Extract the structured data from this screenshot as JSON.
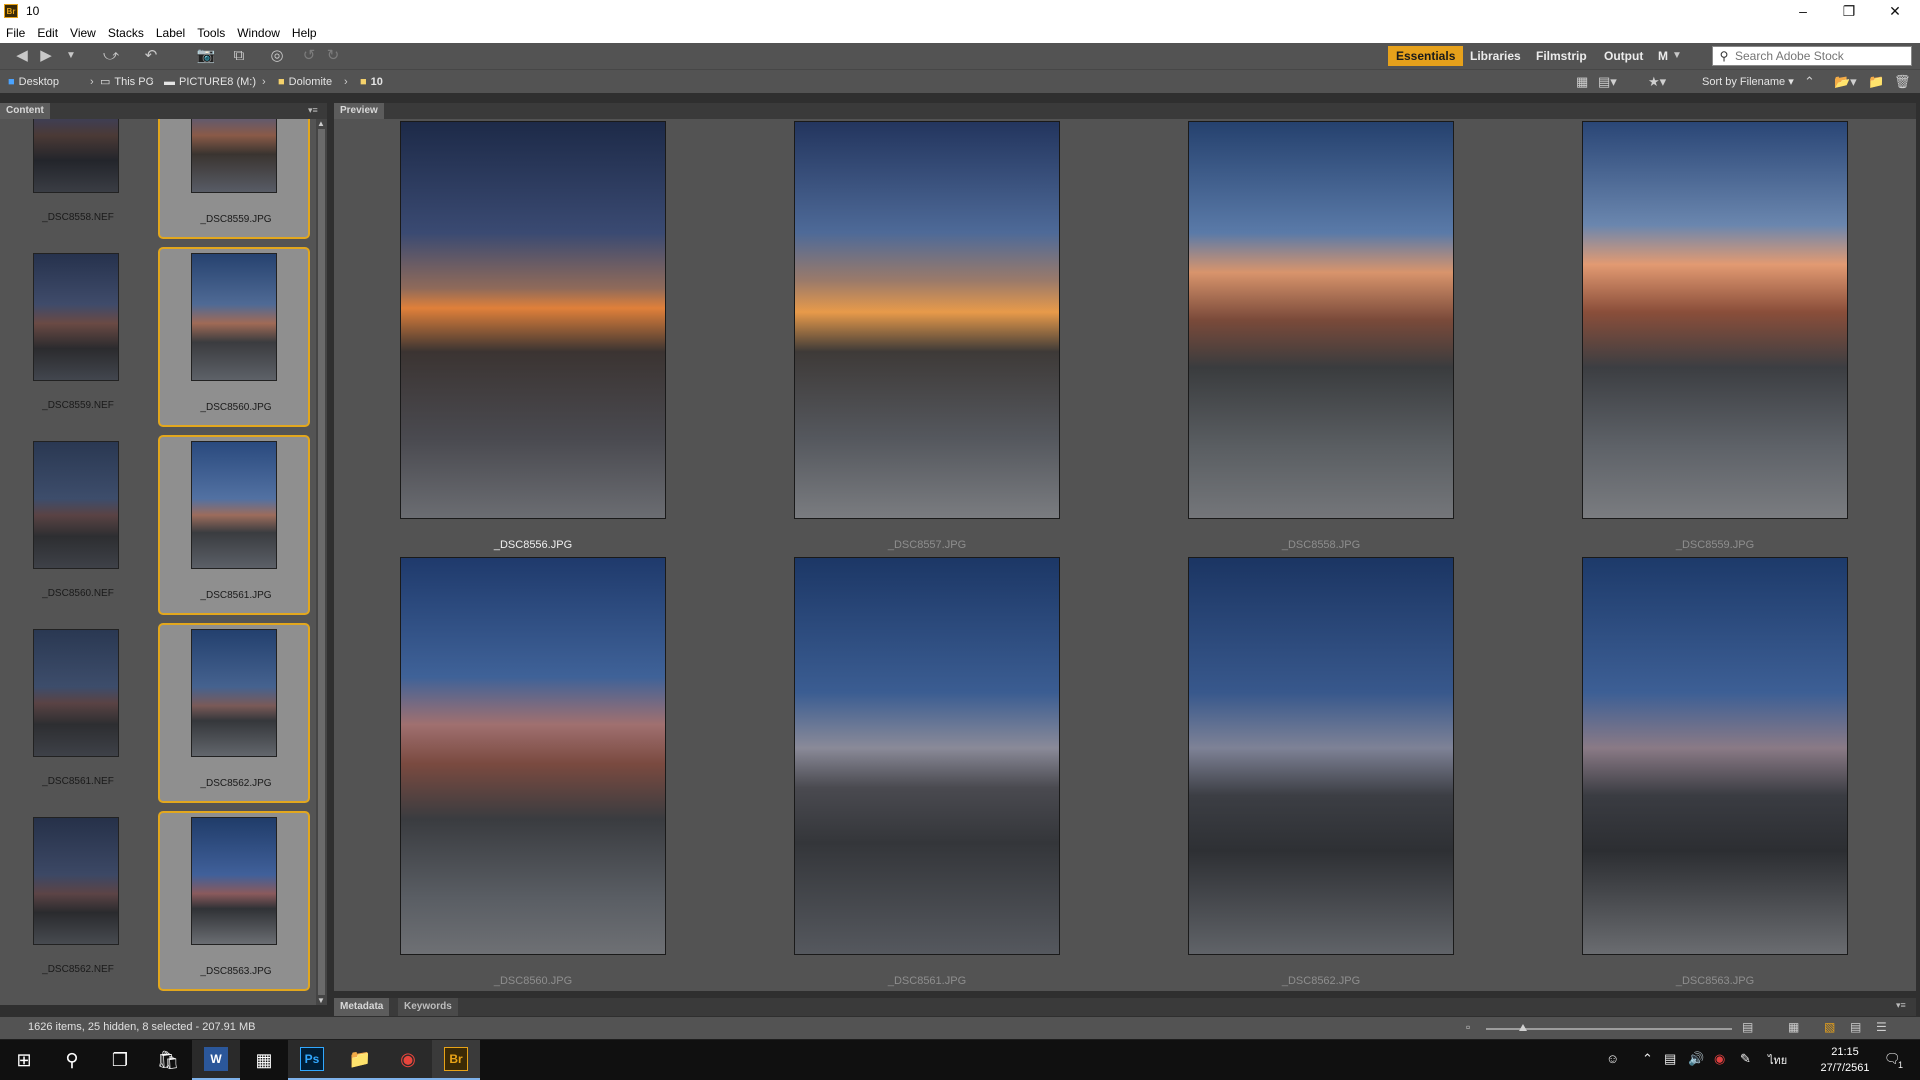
{
  "window": {
    "title": "10"
  },
  "menu": [
    "File",
    "Edit",
    "View",
    "Stacks",
    "Label",
    "Tools",
    "Window",
    "Help"
  ],
  "workspaces": {
    "tabs": [
      "Essentials",
      "Libraries",
      "Filmstrip",
      "Output",
      "M"
    ],
    "active": "Essentials"
  },
  "search": {
    "placeholder": "Search Adobe Stock"
  },
  "path": [
    {
      "label": "Desktop",
      "icon": "desktop-folder-icon"
    },
    {
      "label": "This PC",
      "icon": "computer-icon"
    },
    {
      "label": "PICTURE8 (M:)",
      "icon": "drive-icon"
    },
    {
      "label": "Dolomite",
      "icon": "folder-icon"
    },
    {
      "label": "10",
      "icon": "folder-icon"
    }
  ],
  "sort": {
    "label": "Sort by Filename"
  },
  "panels": {
    "content_tab": "Content",
    "preview_tab": "Preview",
    "metadata_tab": "Metadata",
    "keywords_tab": "Keywords"
  },
  "content_items": [
    {
      "name": "_DSC8558.NEF",
      "selected": false,
      "palette": "dusk-left"
    },
    {
      "name": "_DSC8559.JPG",
      "selected": true,
      "palette": "sunset"
    },
    {
      "name": "_DSC8559.NEF",
      "selected": false,
      "palette": "dusk-hut"
    },
    {
      "name": "_DSC8560.JPG",
      "selected": true,
      "palette": "hut"
    },
    {
      "name": "_DSC8560.NEF",
      "selected": false,
      "palette": "dusk-peaks"
    },
    {
      "name": "_DSC8561.JPG",
      "selected": true,
      "palette": "peaks"
    },
    {
      "name": "_DSC8561.NEF",
      "selected": false,
      "palette": "dusk-peaks"
    },
    {
      "name": "_DSC8562.JPG",
      "selected": true,
      "palette": "hiker"
    },
    {
      "name": "_DSC8562.NEF",
      "selected": false,
      "palette": "dusk-hiker"
    },
    {
      "name": "_DSC8563.JPG",
      "selected": true,
      "palette": "hiker2"
    }
  ],
  "preview_items": [
    {
      "name": "_DSC8556.JPG",
      "focused": true,
      "palette": "sunset-left"
    },
    {
      "name": "_DSC8557.JPG",
      "focused": false,
      "palette": "sunset-center"
    },
    {
      "name": "_DSC8558.JPG",
      "focused": false,
      "palette": "glow-right"
    },
    {
      "name": "_DSC8559.JPG",
      "focused": false,
      "palette": "glow-hut"
    },
    {
      "name": "_DSC8560.JPG",
      "focused": false,
      "palette": "peaks-hut"
    },
    {
      "name": "_DSC8561.JPG",
      "focused": false,
      "palette": "peaks-blue"
    },
    {
      "name": "_DSC8562.JPG",
      "focused": false,
      "palette": "hiker-slope"
    },
    {
      "name": "_DSC8563.JPG",
      "focused": false,
      "palette": "hiker-rock"
    }
  ],
  "status": {
    "text": "1626 items, 25 hidden, 8 selected - 207.91 MB",
    "zoom": 0.15
  },
  "taskbar": {
    "apps": [
      {
        "name": "start",
        "icon": "windows-icon"
      },
      {
        "name": "search",
        "icon": "search-icon"
      },
      {
        "name": "task-view",
        "icon": "task-view-icon"
      },
      {
        "name": "store",
        "icon": "store-icon"
      },
      {
        "name": "word",
        "icon": "word-icon",
        "text": "W"
      },
      {
        "name": "calculator",
        "icon": "calculator-icon"
      },
      {
        "name": "photoshop",
        "icon": "photoshop-icon",
        "text": "Ps"
      },
      {
        "name": "file-explorer",
        "icon": "folder-icon"
      },
      {
        "name": "chrome",
        "icon": "chrome-icon"
      },
      {
        "name": "bridge",
        "icon": "bridge-icon",
        "text": "Br"
      }
    ],
    "clock_time": "21:15",
    "clock_date": "27/7/2561",
    "language": "ไทย",
    "notification_count": "1"
  }
}
